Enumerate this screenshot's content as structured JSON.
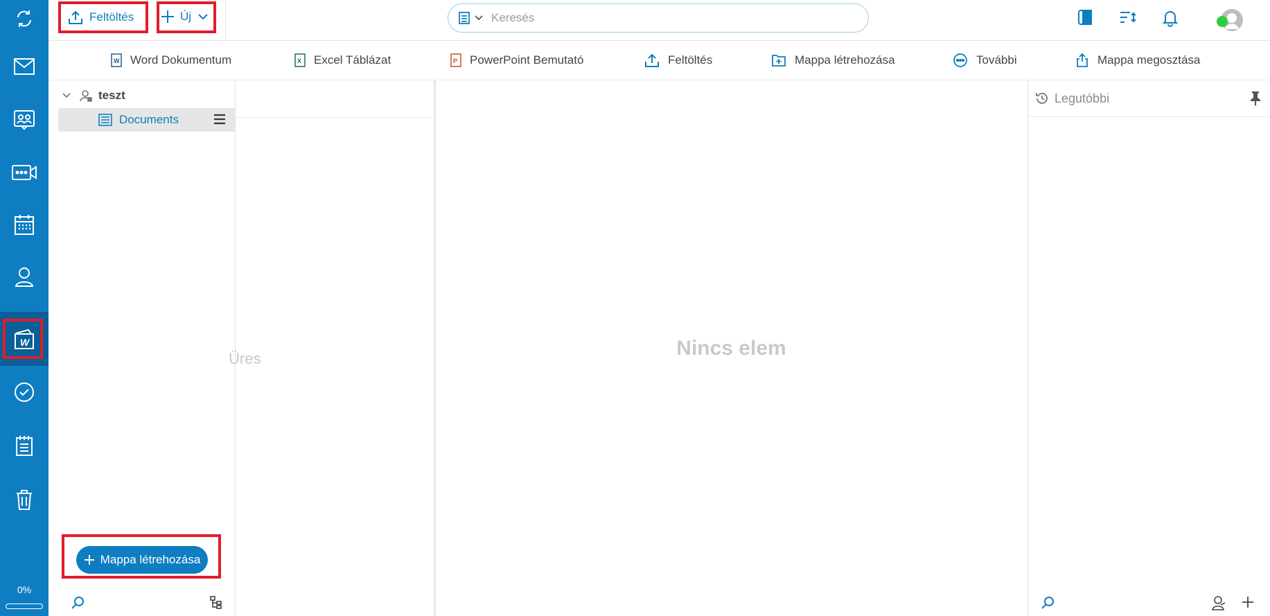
{
  "rail": {
    "items": [
      "sync",
      "mail",
      "contacts",
      "meetings",
      "calendar",
      "profile",
      "documents",
      "tasks",
      "notes",
      "trash"
    ],
    "active": "documents",
    "storage_percent": "0%",
    "storage_fraction": 0
  },
  "topbar": {
    "upload_label": "Feltöltés",
    "new_label": "Új",
    "search_placeholder": "Keresés"
  },
  "toolbar": {
    "word": "Word Dokumentum",
    "excel": "Excel Táblázat",
    "powerpoint": "PowerPoint Bemutató",
    "upload": "Feltöltés",
    "create_folder": "Mappa létrehozása",
    "more": "További",
    "share_folder": "Mappa megosztása"
  },
  "tree": {
    "root": "teszt",
    "documents": "Documents",
    "create_folder_button": "Mappa létrehozása"
  },
  "column2": {
    "empty_text": "Üres"
  },
  "main": {
    "empty_text": "Nincs elem"
  },
  "right": {
    "title": "Legutóbbi"
  },
  "colors": {
    "brand": "#0f7dc2",
    "highlight": "#e11d2a",
    "status_online": "#2ecc40"
  }
}
